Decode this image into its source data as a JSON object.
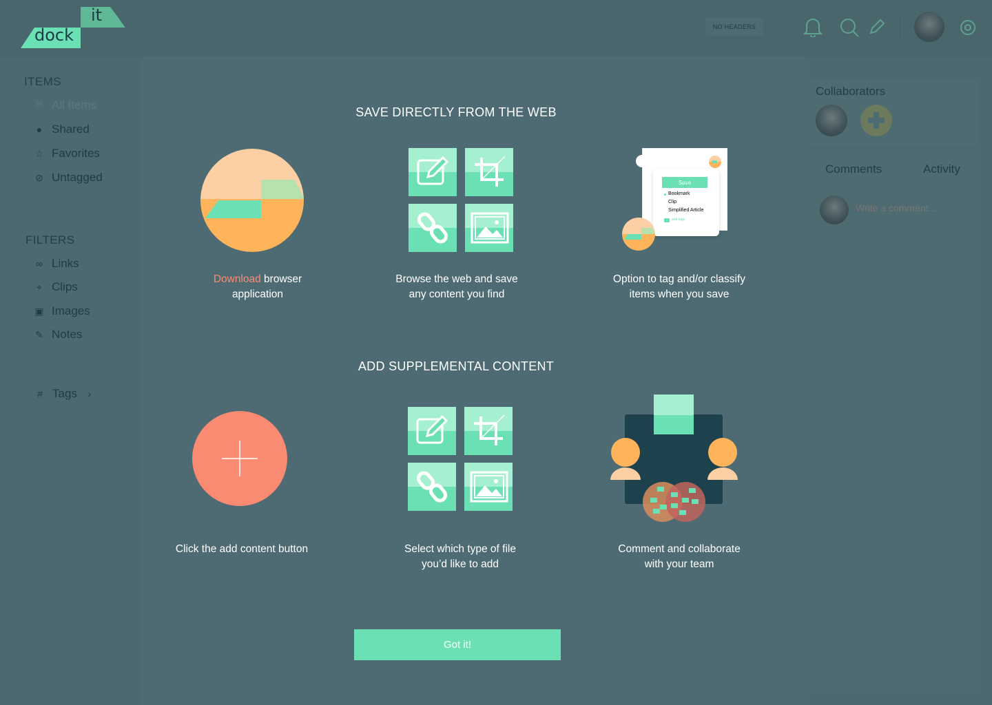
{
  "app": {
    "logo_top": "it",
    "logo_bottom": "dock",
    "header_badge": "NO HEADERS"
  },
  "sidebar": {
    "items_heading": "ITEMS",
    "items": [
      {
        "label": "All Items",
        "icon": "document-icon",
        "active": true
      },
      {
        "label": "Shared",
        "icon": "users-icon"
      },
      {
        "label": "Favorites",
        "icon": "star-icon"
      },
      {
        "label": "Untagged",
        "icon": "untagged-icon"
      }
    ],
    "filters_heading": "FILTERS",
    "filters": [
      {
        "label": "Links",
        "icon": "link-icon"
      },
      {
        "label": "Clips",
        "icon": "crop-icon"
      },
      {
        "label": "Images",
        "icon": "image-icon"
      },
      {
        "label": "Notes",
        "icon": "edit-icon"
      }
    ],
    "tags_label": "Tags"
  },
  "right_panel": {
    "collaborators_title": "Collaborators",
    "tabs": [
      "Comments",
      "Activity"
    ],
    "comment_placeholder": "Write a comment..."
  },
  "onboarding": {
    "section1": {
      "title": "SAVE DIRECTLY FROM THE WEB",
      "step1_link": "Download",
      "step1_rest": " browser",
      "step1_line2": "application",
      "step2_line1": "Browse the web and save",
      "step2_line2": "any content you find",
      "step3_line1": "Option to tag and/or classify",
      "step3_line2": "items when you save",
      "popup": {
        "save_label": "Save",
        "options": [
          "Bookmark",
          "Clip",
          "Simplified Article"
        ],
        "add_tags": "add tags"
      }
    },
    "section2": {
      "title": "ADD SUPPLEMENTAL CONTENT",
      "step1": "Click the add content button",
      "step2_line1": "Select which type of file",
      "step2_line2": "you’d like to add",
      "step3_line1": "Comment and collaborate",
      "step3_line2": "with your team"
    },
    "got_it_label": "Got it!"
  },
  "colors": {
    "accent_green": "#6be0b4",
    "light_green": "#a4f0d0",
    "coral": "#fa8a72",
    "orange": "#ffb35a",
    "peach": "#fdcfa4",
    "overlay_bg": "#4c6870"
  }
}
